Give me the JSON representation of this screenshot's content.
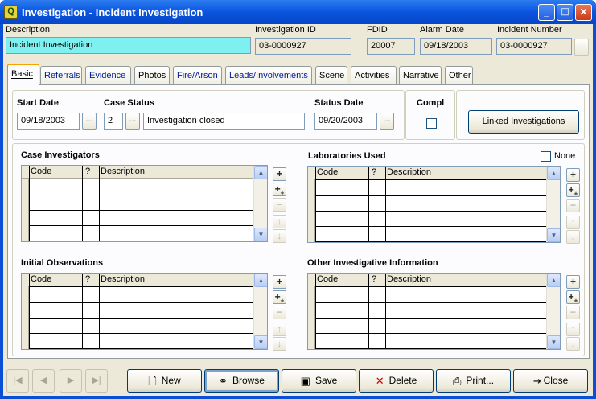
{
  "window": {
    "title": "Investigation - Incident Investigation",
    "app_icon_glyph": "Q"
  },
  "header": {
    "description_label": "Description",
    "description_value": "Incident Investigation",
    "investigation_id_label": "Investigation ID",
    "investigation_id_value": "03-0000927",
    "fdid_label": "FDID",
    "fdid_value": "20007",
    "alarm_date_label": "Alarm Date",
    "alarm_date_value": "09/18/2003",
    "incident_number_label": "Incident Number",
    "incident_number_value": "03-0000927",
    "lookup_label": "..."
  },
  "tabs": [
    "Basic",
    "Referrals",
    "Evidence",
    "Photos",
    "Fire/Arson",
    "Leads/Involvements",
    "Scene",
    "Activities",
    "Narrative",
    "Other"
  ],
  "basic": {
    "start_date_label": "Start Date",
    "start_date_value": "09/18/2003",
    "case_status_label": "Case Status",
    "case_status_code": "2",
    "case_status_desc": "Investigation closed",
    "status_date_label": "Status Date",
    "status_date_value": "09/20/2003",
    "compl_label": "Compl",
    "linked_button": "Linked Investigations",
    "dots": "..."
  },
  "grids": {
    "columns": {
      "code": "Code",
      "q": "?",
      "description": "Description"
    },
    "case_investigators": "Case Investigators",
    "laboratories_used": "Laboratories Used",
    "none_label": "None",
    "initial_observations": "Initial Observations",
    "other_info": "Other Investigative Information"
  },
  "toolbar": {
    "new": "New",
    "browse": "Browse",
    "save": "Save",
    "delete": "Delete",
    "print": "Print...",
    "close": "Close"
  },
  "colors": {
    "title_bar": "#0a55e0",
    "description_field": "#7ff0f0",
    "client": "#ece9d8"
  }
}
